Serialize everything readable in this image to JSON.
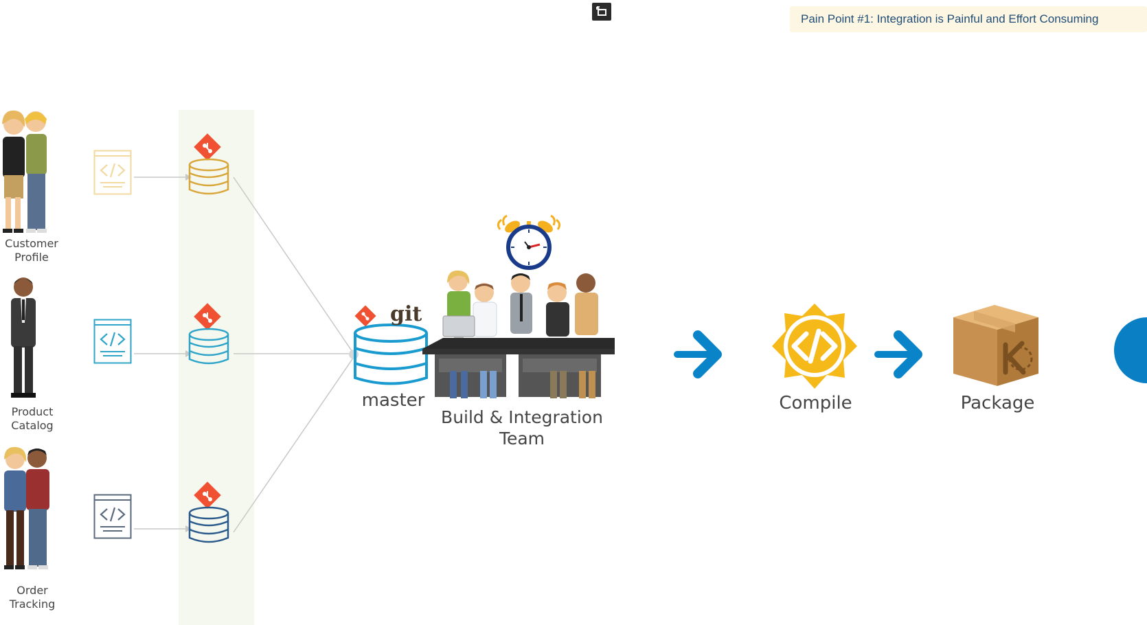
{
  "banner": {
    "text": "Pain Point #1: Integration is Painful and Effort Consuming"
  },
  "teams": [
    {
      "line1": "Customer",
      "line2": "Profile",
      "repo_color": "#d9a63a",
      "code_color": "#f1d9a0"
    },
    {
      "line1": "Product",
      "line2": "Catalog",
      "repo_color": "#2fa4c9",
      "code_color": "#2fa4c9"
    },
    {
      "line1": "Order",
      "line2": "Tracking",
      "repo_color": "#2a5a8c",
      "code_color": "#5a6a7c"
    }
  ],
  "master": {
    "git_label": "git",
    "label": "master"
  },
  "build_team": {
    "line1": "Build & Integration",
    "line2": "Team"
  },
  "stages": {
    "compile": "Compile",
    "package": "Package"
  },
  "colors": {
    "git_orange": "#f05133",
    "arrow_blue": "#0a84c9",
    "repo_master": "#1a9bd0",
    "compile_gold": "#f5b91a",
    "banner_text": "#1f4d77"
  }
}
